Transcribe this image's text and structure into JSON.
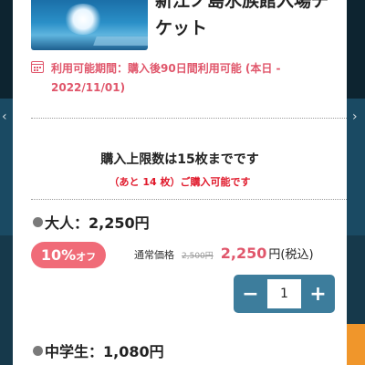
{
  "ticket": {
    "title_line1": "新江ノ島水族館入場チ",
    "title_line2": "ケット",
    "image_icon": "aquarium-photo"
  },
  "validity": {
    "icon": "calendar-icon",
    "text": "利用可能期間：購入後90日間利用可能 (本日 - 2022/11/01)"
  },
  "purchase_limit": {
    "text": "購入上限数は15枚までです",
    "remaining": "（あと 14 枚）ご購入可能です"
  },
  "adult": {
    "heading": "大人：2,250円",
    "discount_pct": "10%",
    "discount_off": "オフ",
    "regular_label": "通常価格",
    "regular_price": "2,500円",
    "sale_price": "2,250",
    "sale_unit": "円(税込)",
    "quantity": "1",
    "minus_label": "−",
    "plus_label": "+"
  },
  "student": {
    "heading": "中学生：1,080円"
  },
  "background": {
    "prev_arrow": "‹",
    "next_arrow": "›"
  },
  "colors": {
    "accent_pink": "#e0566b",
    "badge_pink": "#f06b78",
    "stepper_blue": "#3d7d9c",
    "warning_red": "#e0192b"
  }
}
